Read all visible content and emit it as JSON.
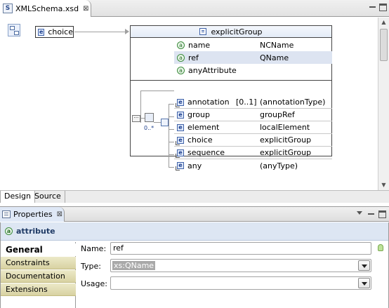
{
  "editor": {
    "tab_label": "XMLSchema.xsd",
    "tab_close": "⊠"
  },
  "diagram": {
    "choice_label": "choice",
    "group_title": "explicitGroup",
    "attributes": [
      {
        "name": "name",
        "type": "NCName",
        "selected": false
      },
      {
        "name": "ref",
        "type": "QName",
        "selected": true
      },
      {
        "name": "anyAttribute",
        "type": "",
        "selected": false
      }
    ],
    "particles": [
      {
        "name": "annotation",
        "occurrence": "[0..1]",
        "type": "(annotationType)"
      },
      {
        "name": "group",
        "occurrence": "",
        "type": "groupRef"
      },
      {
        "name": "element",
        "occurrence": "",
        "type": "localElement"
      },
      {
        "name": "choice",
        "occurrence": "",
        "type": "explicitGroup"
      },
      {
        "name": "sequence",
        "occurrence": "",
        "type": "explicitGroup"
      },
      {
        "name": "any",
        "occurrence": "",
        "type": "(anyType)"
      }
    ],
    "choice_occurrence": "0..*"
  },
  "bottom_tabs": [
    "Design",
    "Source"
  ],
  "properties": {
    "tab_label": "Properties",
    "tab_close": "⊠",
    "header": "attribute",
    "categories": [
      "General",
      "Constraints",
      "Documentation",
      "Extensions"
    ],
    "active_category": "General",
    "name_label": "Name:",
    "name_value": "ref",
    "type_label": "Type:",
    "type_value": "xs:QName",
    "usage_label": "Usage:",
    "usage_value": ""
  }
}
